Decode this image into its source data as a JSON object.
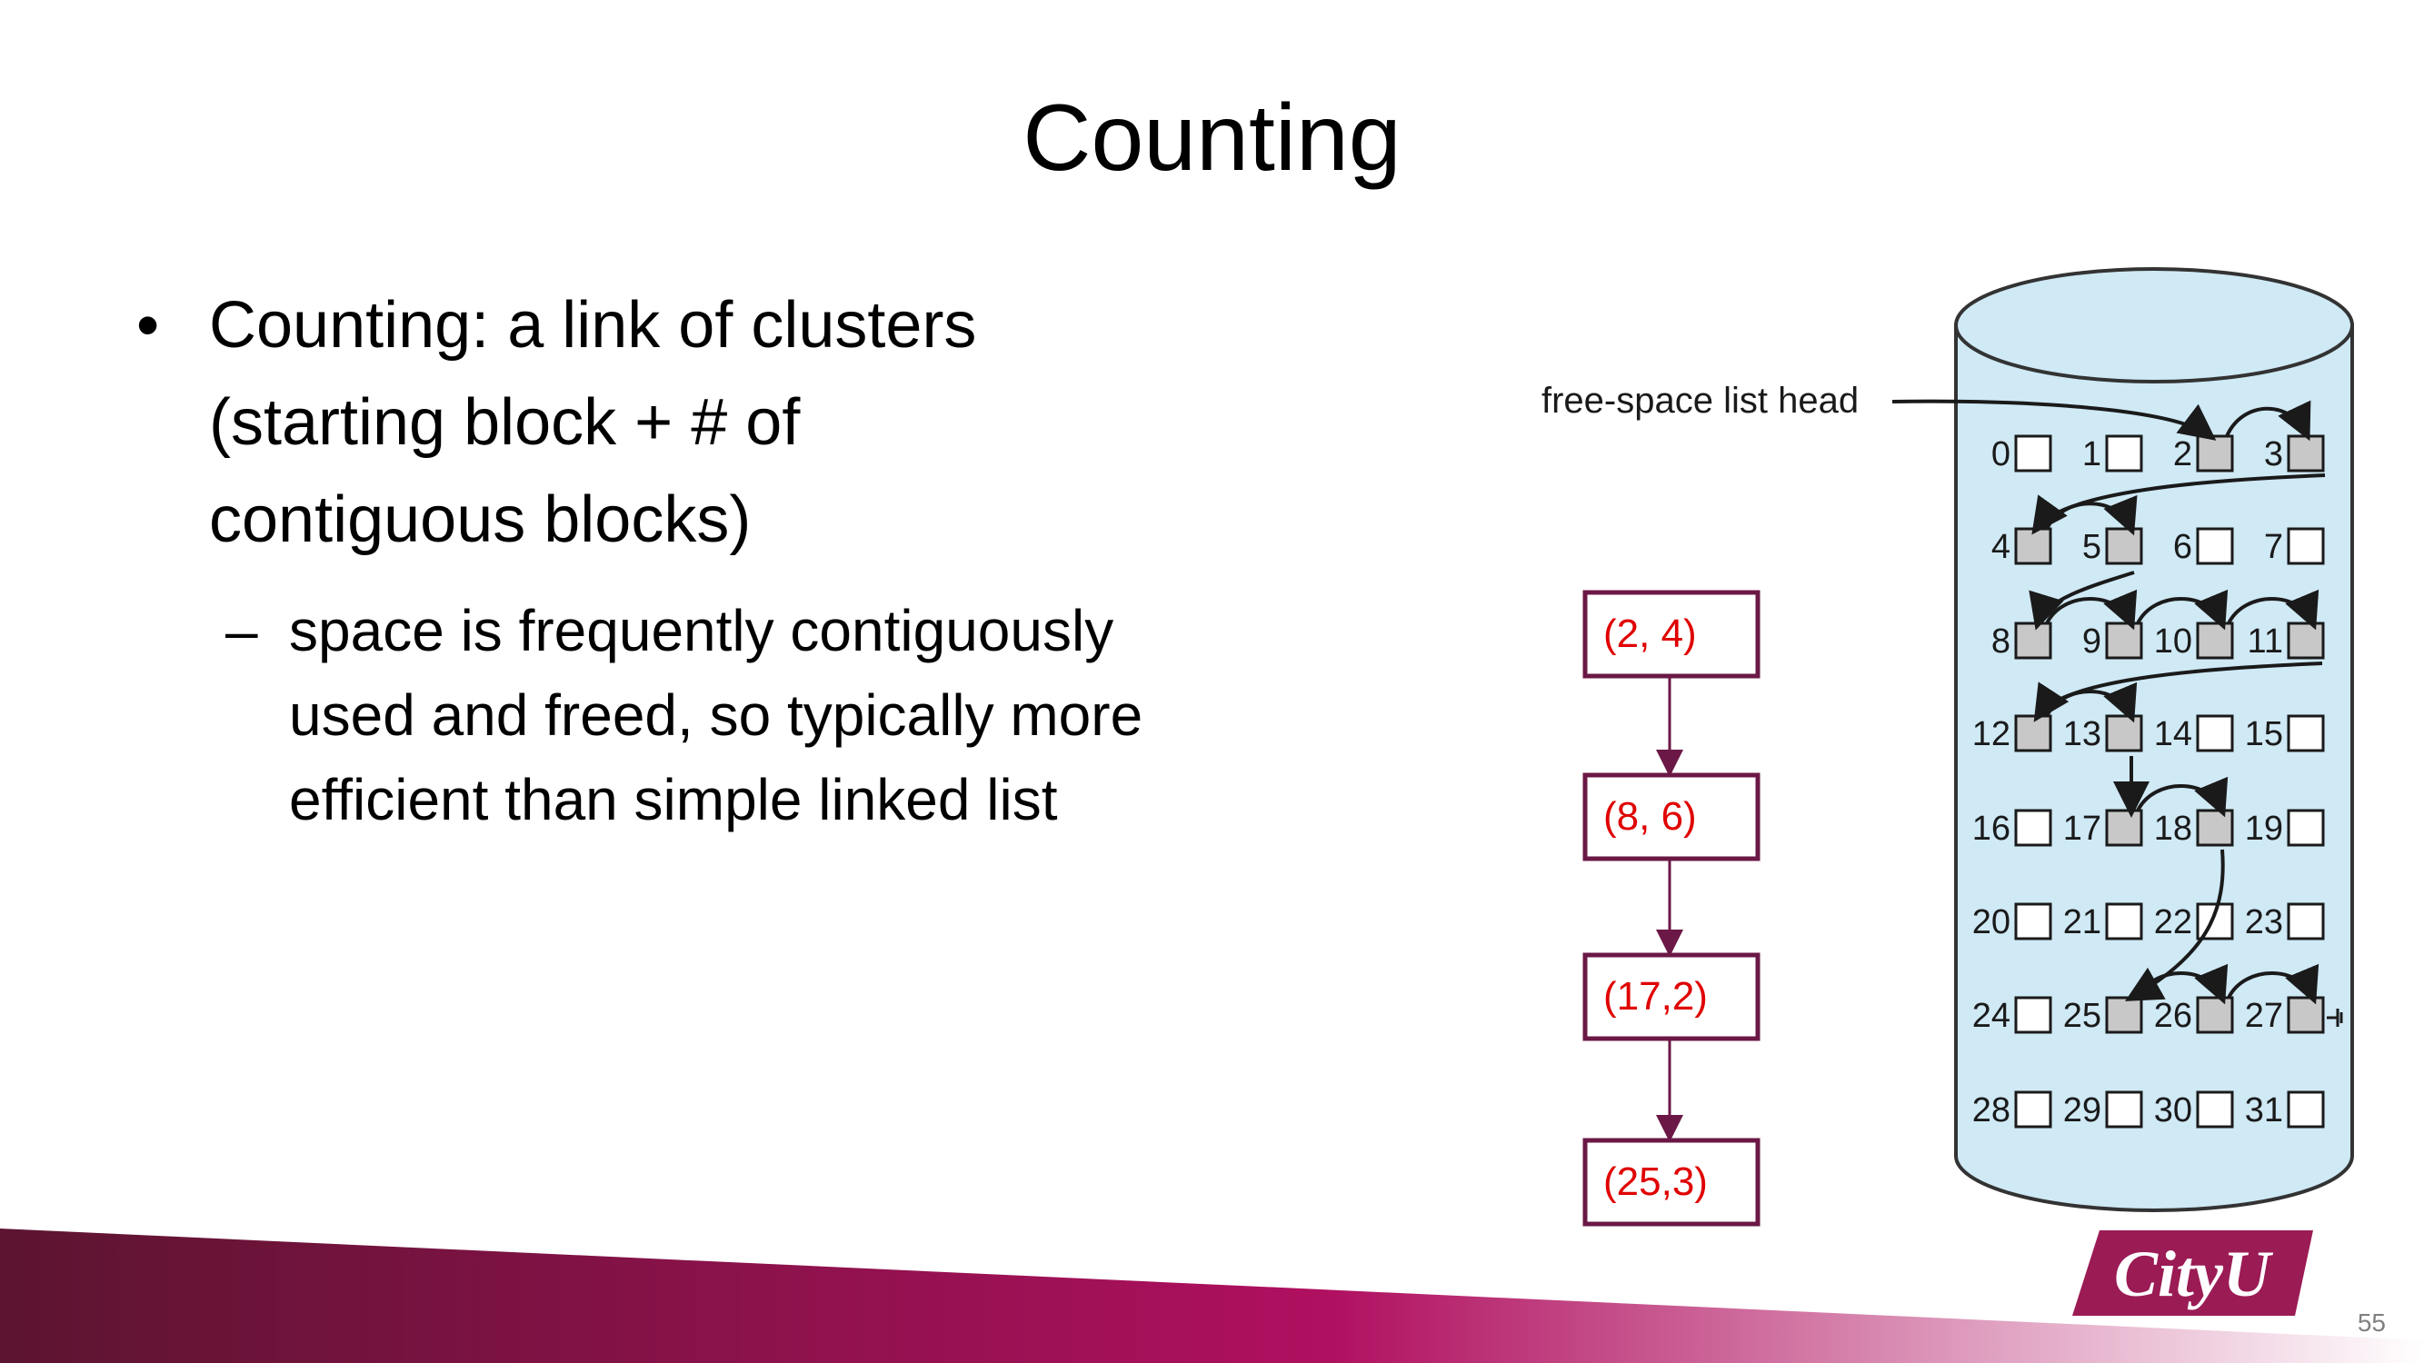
{
  "slide": {
    "title": "Counting",
    "bullet": {
      "marker": "•",
      "lines": [
        "Counting: a link of clusters",
        "(starting block + # of",
        "contiguous blocks)"
      ]
    },
    "sub_bullet": {
      "marker": "–",
      "lines": [
        "space is frequently contiguously",
        "used and freed, so typically more",
        "efficient than simple linked list"
      ]
    },
    "page_number": "55",
    "logo_text": "CityU"
  },
  "diagram": {
    "head_label": "free-space list head",
    "blocks": [
      {
        "n": 0,
        "free": false
      },
      {
        "n": 1,
        "free": false
      },
      {
        "n": 2,
        "free": true
      },
      {
        "n": 3,
        "free": true
      },
      {
        "n": 4,
        "free": true
      },
      {
        "n": 5,
        "free": true
      },
      {
        "n": 6,
        "free": false
      },
      {
        "n": 7,
        "free": false
      },
      {
        "n": 8,
        "free": true
      },
      {
        "n": 9,
        "free": true
      },
      {
        "n": 10,
        "free": true
      },
      {
        "n": 11,
        "free": true
      },
      {
        "n": 12,
        "free": true
      },
      {
        "n": 13,
        "free": true
      },
      {
        "n": 14,
        "free": false
      },
      {
        "n": 15,
        "free": false
      },
      {
        "n": 16,
        "free": false
      },
      {
        "n": 17,
        "free": true
      },
      {
        "n": 18,
        "free": true
      },
      {
        "n": 19,
        "free": false
      },
      {
        "n": 20,
        "free": false
      },
      {
        "n": 21,
        "free": false
      },
      {
        "n": 22,
        "free": false
      },
      {
        "n": 23,
        "free": false
      },
      {
        "n": 24,
        "free": false
      },
      {
        "n": 25,
        "free": true
      },
      {
        "n": 26,
        "free": true
      },
      {
        "n": 27,
        "free": true
      },
      {
        "n": 28,
        "free": false
      },
      {
        "n": 29,
        "free": false
      },
      {
        "n": 30,
        "free": false
      },
      {
        "n": 31,
        "free": false
      }
    ],
    "clusters": [
      "(2, 4)",
      "(8, 6)",
      "(17,2)",
      "(25,3)"
    ]
  },
  "colors": {
    "cylinder_fill": "#cfe9f5",
    "free_block": "#c8c8c8",
    "empty_block": "#ffffff",
    "cluster_border": "#6b1846",
    "cluster_text": "#e00000",
    "banner_dark": "#5c1430",
    "banner_light": "#b01060"
  }
}
